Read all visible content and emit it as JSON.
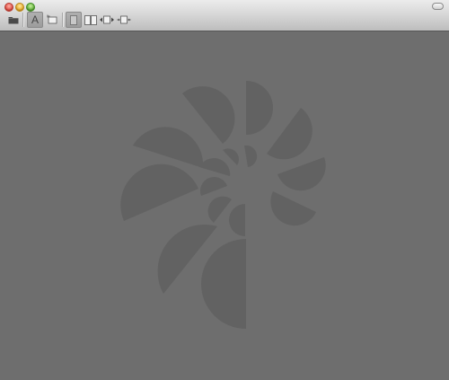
{
  "window": {
    "controls": [
      "close",
      "minimize",
      "zoom"
    ]
  },
  "toolbar": {
    "buttons": [
      {
        "icon": "folder-icon"
      },
      {
        "icon": "text-mode-icon",
        "label": "A",
        "pressed": true
      },
      {
        "icon": "frame-select-icon"
      },
      {
        "icon": "single-page-icon",
        "pressed": true
      },
      {
        "icon": "two-page-icon"
      },
      {
        "icon": "fit-width-icon"
      },
      {
        "icon": "fit-page-icon"
      }
    ]
  },
  "content": {
    "watermark": "app-logo-watermark"
  },
  "colors": {
    "background": "#6e6e6e",
    "watermark": "#5f5f5f"
  }
}
